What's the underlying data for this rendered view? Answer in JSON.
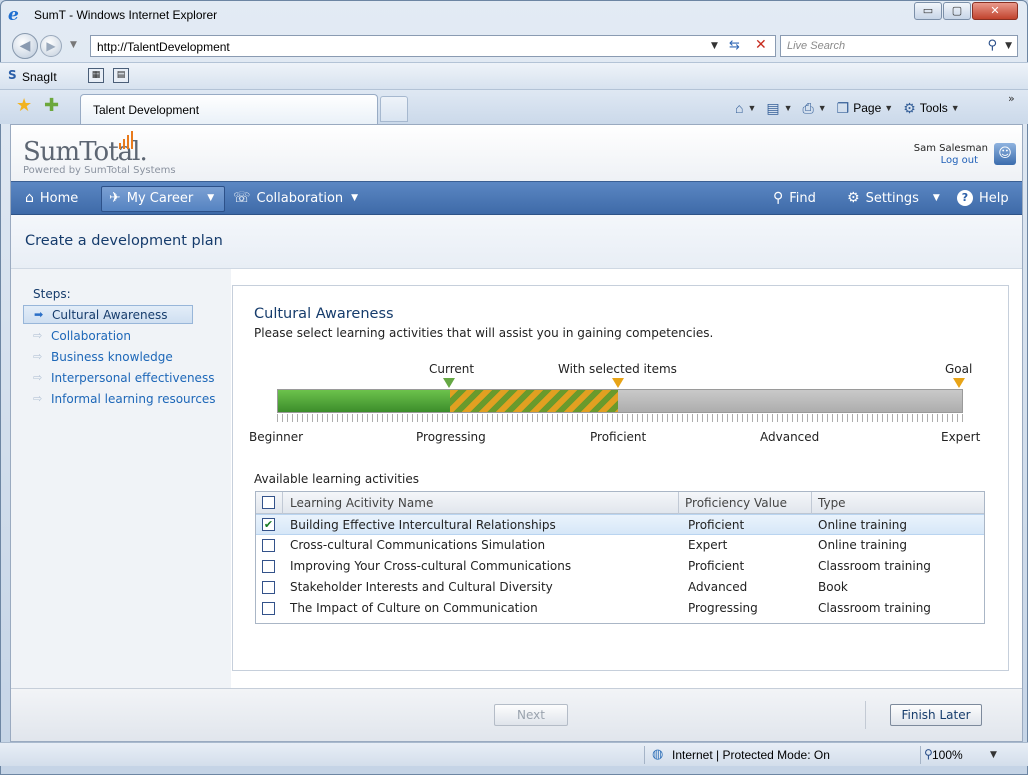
{
  "window": {
    "title": "SumT  - Windows Internet Explorer",
    "buttons": {
      "minimize": "▭",
      "maximize": "▢",
      "close": "✕"
    }
  },
  "navbar": {
    "address": "http://TalentDevelopment",
    "search_placeholder": "Live Search"
  },
  "links_bar": {
    "snagit_label": "SnagIt"
  },
  "tabs": {
    "active_tab": "Talent Development",
    "commands": [
      {
        "icon": "home-icon",
        "glyph": "⌂",
        "label": ""
      },
      {
        "icon": "feeds-icon",
        "glyph": "▤",
        "label": ""
      },
      {
        "icon": "print-icon",
        "glyph": "⎙",
        "label": ""
      },
      {
        "icon": "page-icon",
        "glyph": "❐",
        "label": "Page"
      },
      {
        "icon": "tools-icon",
        "glyph": "⚙",
        "label": "Tools"
      }
    ],
    "more": "»"
  },
  "header": {
    "logo_main": "SumTotal.",
    "logo_sub": "Powered by SumTotal Systems",
    "user_name": "Sam Salesman",
    "logout": "Log out"
  },
  "nav": {
    "home": "Home",
    "my_career": "My Career",
    "collaboration": "Collaboration",
    "find": "Find",
    "settings": "Settings",
    "help": "Help"
  },
  "page_title": "Create a development plan",
  "steps": {
    "label": "Steps:",
    "items": [
      {
        "label": "Cultural Awareness",
        "active": true
      },
      {
        "label": "Collaboration",
        "active": false
      },
      {
        "label": "Business knowledge",
        "active": false
      },
      {
        "label": "Interpersonal effectiveness",
        "active": false
      },
      {
        "label": "Informal learning resources",
        "active": false
      }
    ]
  },
  "competency": {
    "title": "Cultural Awareness",
    "description": "Please select learning activities that will assist you in gaining competencies.",
    "markers": {
      "current": "Current",
      "with_selected": "With selected items",
      "goal": "Goal"
    },
    "scale": [
      "Beginner",
      "Progressing",
      "Proficient",
      "Advanced",
      "Expert"
    ],
    "progress": {
      "current_fraction": 0.25,
      "with_selected_fraction": 0.5,
      "goal_fraction": 1.0
    }
  },
  "activities": {
    "label": "Available learning activities",
    "columns": [
      "Learning Acitivity Name",
      "Proficiency Value",
      "Type"
    ],
    "rows": [
      {
        "name": "Building Effective Intercultural Relationships",
        "proficiency": "Proficient",
        "type": "Online training",
        "checked": true
      },
      {
        "name": "Cross-cultural Communications Simulation",
        "proficiency": "Expert",
        "type": "Online training",
        "checked": false
      },
      {
        "name": "Improving Your Cross-cultural Communications",
        "proficiency": "Proficient",
        "type": "Classroom training",
        "checked": false
      },
      {
        "name": "Stakeholder Interests and Cultural Diversity",
        "proficiency": "Advanced",
        "type": "Book",
        "checked": false
      },
      {
        "name": "The Impact of Culture on Communication",
        "proficiency": "Progressing",
        "type": "Classroom training",
        "checked": false
      }
    ]
  },
  "footer": {
    "next": "Next",
    "finish_later": "Finish Later"
  },
  "status": {
    "zone": "Internet | Protected Mode: On",
    "zoom": "100%"
  }
}
